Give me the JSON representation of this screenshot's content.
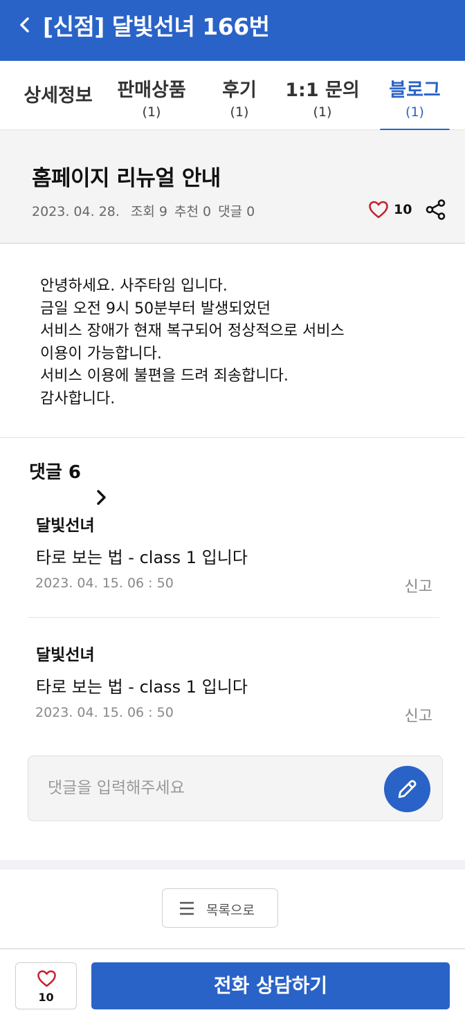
{
  "header": {
    "title": "[신점] 달빛선녀 166번",
    "back_icon": "chevron-left-icon"
  },
  "tabs": [
    {
      "label": "상세정보",
      "count": ""
    },
    {
      "label": "판매상품",
      "count": "(1)"
    },
    {
      "label": "후기",
      "count": "(1)"
    },
    {
      "label": "1:1 문의",
      "count": "(1)"
    },
    {
      "label": "블로그",
      "count": "(1)",
      "active": true
    }
  ],
  "post": {
    "title": "홈페이지 리뉴얼 안내",
    "date": "2023. 04. 28.",
    "views": "조회 9",
    "recommends": "추천 0",
    "comments": "댓글 0",
    "like_count": "10",
    "body": [
      "안녕하세요. 사주타임 입니다.",
      "금일 오전 9시 50분부터 발생되었던",
      "서비스 장애가 현재 복구되어 정상적으로 서비스",
      "이용이 가능합니다.",
      "서비스 이용에 불편을 드려 죄송합니다.",
      "감사합니다."
    ]
  },
  "comments_section": {
    "title": "댓글 6",
    "items": [
      {
        "author": "달빛선녀",
        "text": "타로 보는 법 - class 1 입니다",
        "date": "2023. 04. 15.  06 : 50",
        "report": "신고"
      },
      {
        "author": "달빛선녀",
        "text": "타로 보는 법 - class 1 입니다",
        "date": "2023. 04. 15.  06 : 50",
        "report": "신고"
      }
    ],
    "input_placeholder": "댓글을 입력해주세요"
  },
  "list_button": {
    "label": "목록으로"
  },
  "bottom_bar": {
    "like_count": "10",
    "call_label": "전화 상담하기"
  },
  "colors": {
    "brand": "#2a63c7",
    "like_red": "#c8202c"
  }
}
